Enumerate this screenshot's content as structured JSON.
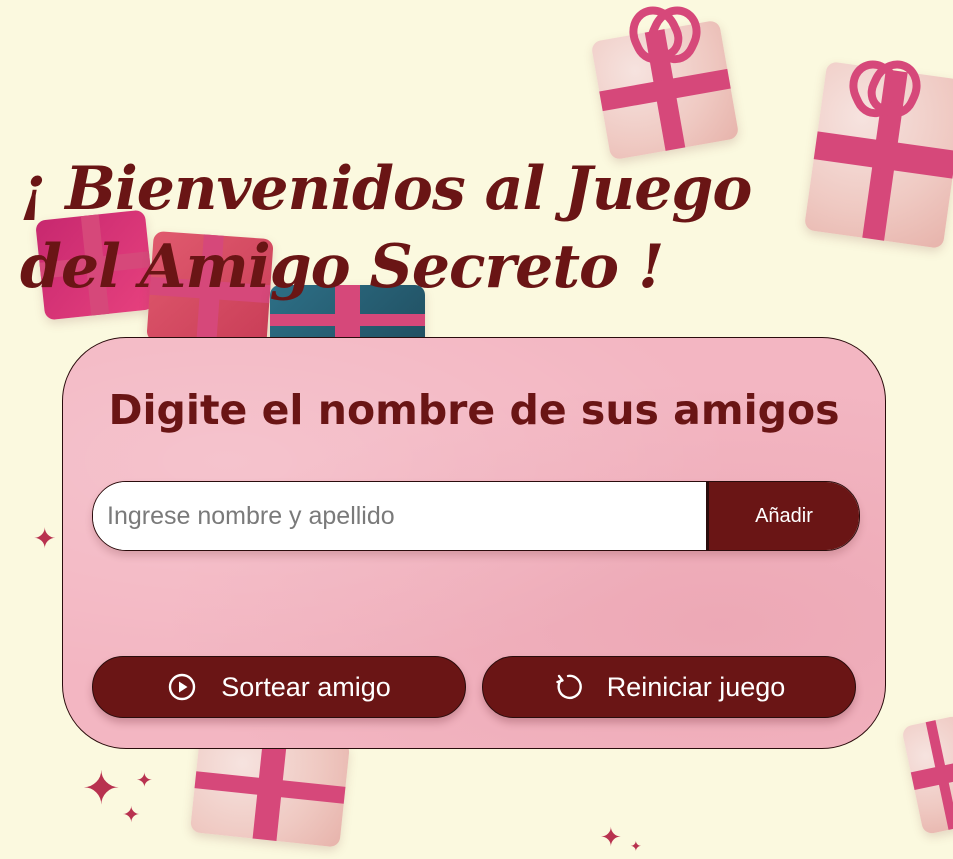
{
  "header": {
    "title": "¡ Bienvenidos al Juego del Amigo Secreto !"
  },
  "card": {
    "heading": "Digite el nombre de sus amigos",
    "input": {
      "value": "",
      "placeholder": "Ingrese nombre y apellido"
    },
    "add_label": "Añadir",
    "draw_label": "Sortear amigo",
    "reset_label": "Reiniciar juego"
  },
  "icons": {
    "draw": "play-circle-icon",
    "reset": "refresh-icon",
    "decorations": [
      "gift-icon",
      "sparkle-icon"
    ]
  },
  "colors": {
    "background": "#fbf9df",
    "accent": "#6a1515",
    "card": "#f3b6c2",
    "ribbon": "#d6487a"
  }
}
